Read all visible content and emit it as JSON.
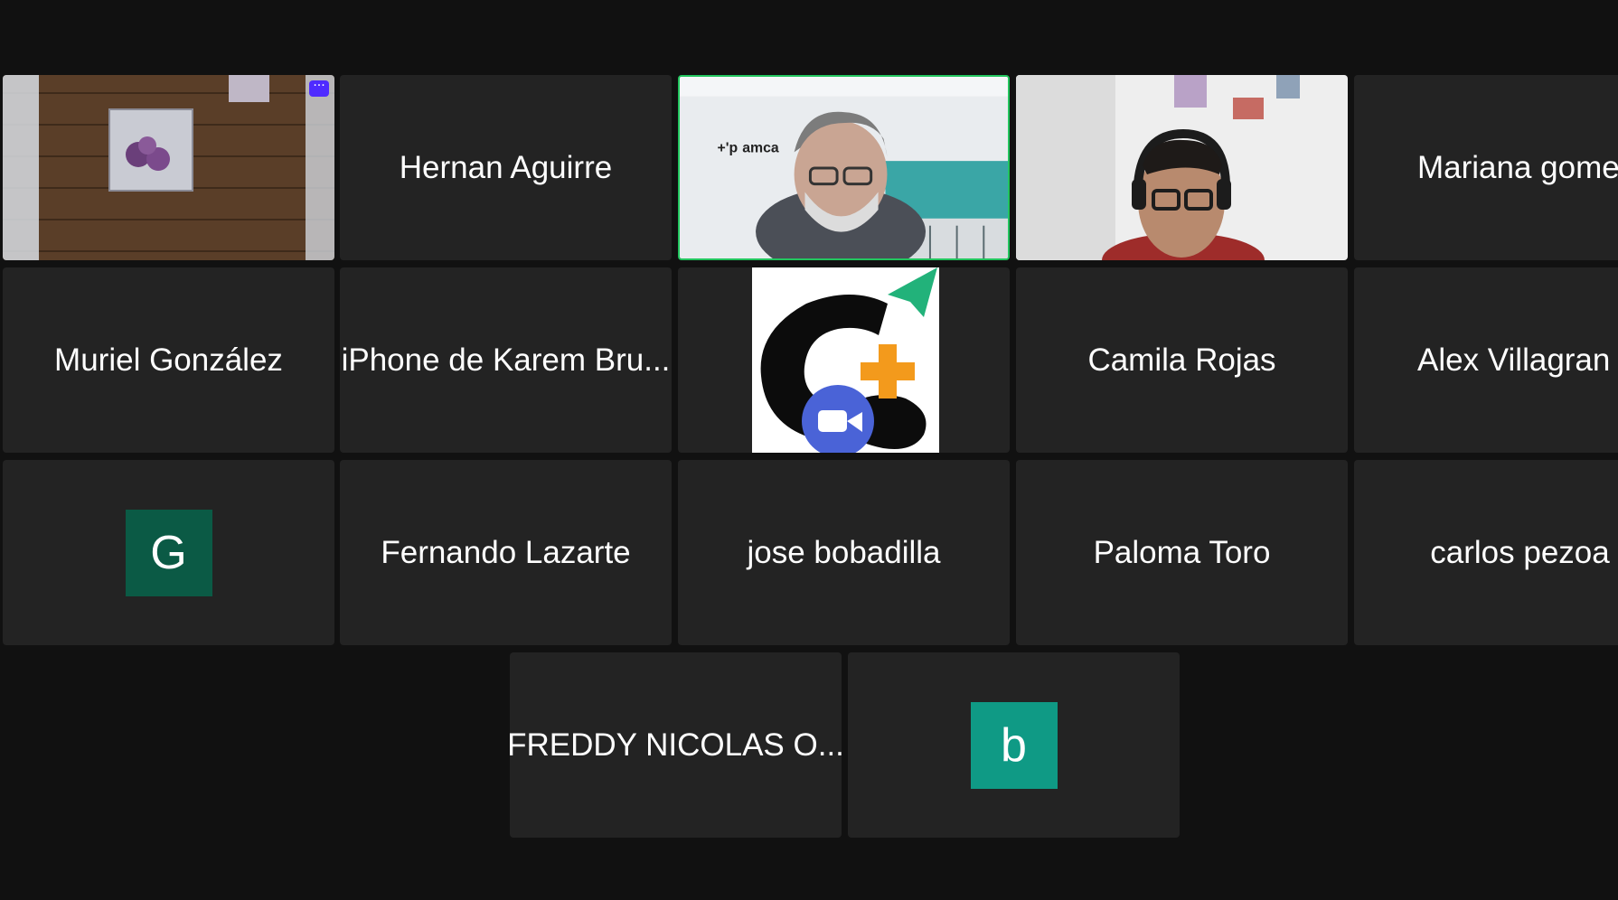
{
  "participants": {
    "row1": [
      {
        "type": "video",
        "icon": "room-floor-video"
      },
      {
        "type": "name",
        "name": "Hernan Aguirre"
      },
      {
        "type": "video",
        "icon": "speaker-man-glasses-video",
        "active": true
      },
      {
        "type": "video",
        "icon": "man-headset-video"
      },
      {
        "type": "name",
        "name": "Mariana gomez"
      }
    ],
    "row2": [
      {
        "type": "name",
        "name": "Muriel González"
      },
      {
        "type": "name",
        "name": "iPhone de Karem Bru..."
      },
      {
        "type": "logo",
        "icon": "c3-zoom-logo"
      },
      {
        "type": "name",
        "name": "Camila Rojas"
      },
      {
        "type": "name",
        "name": "Alex Villagran"
      }
    ],
    "row3": [
      {
        "type": "avatar",
        "initial": "G",
        "color": "#0b5a45"
      },
      {
        "type": "name",
        "name": "Fernando Lazarte"
      },
      {
        "type": "name",
        "name": "jose bobadilla"
      },
      {
        "type": "name",
        "name": "Paloma Toro"
      },
      {
        "type": "name",
        "name": "carlos pezoa"
      }
    ],
    "row4": [
      {
        "type": "name",
        "name": "FREDDY NICOLAS O..."
      },
      {
        "type": "avatar",
        "initial": "b",
        "color": "#0f9a85"
      }
    ]
  },
  "more_button": {
    "label": "···"
  },
  "colors": {
    "background": "#111111",
    "tile": "#232323",
    "active_border": "#22c55e",
    "more_button": "#4f2bff"
  }
}
